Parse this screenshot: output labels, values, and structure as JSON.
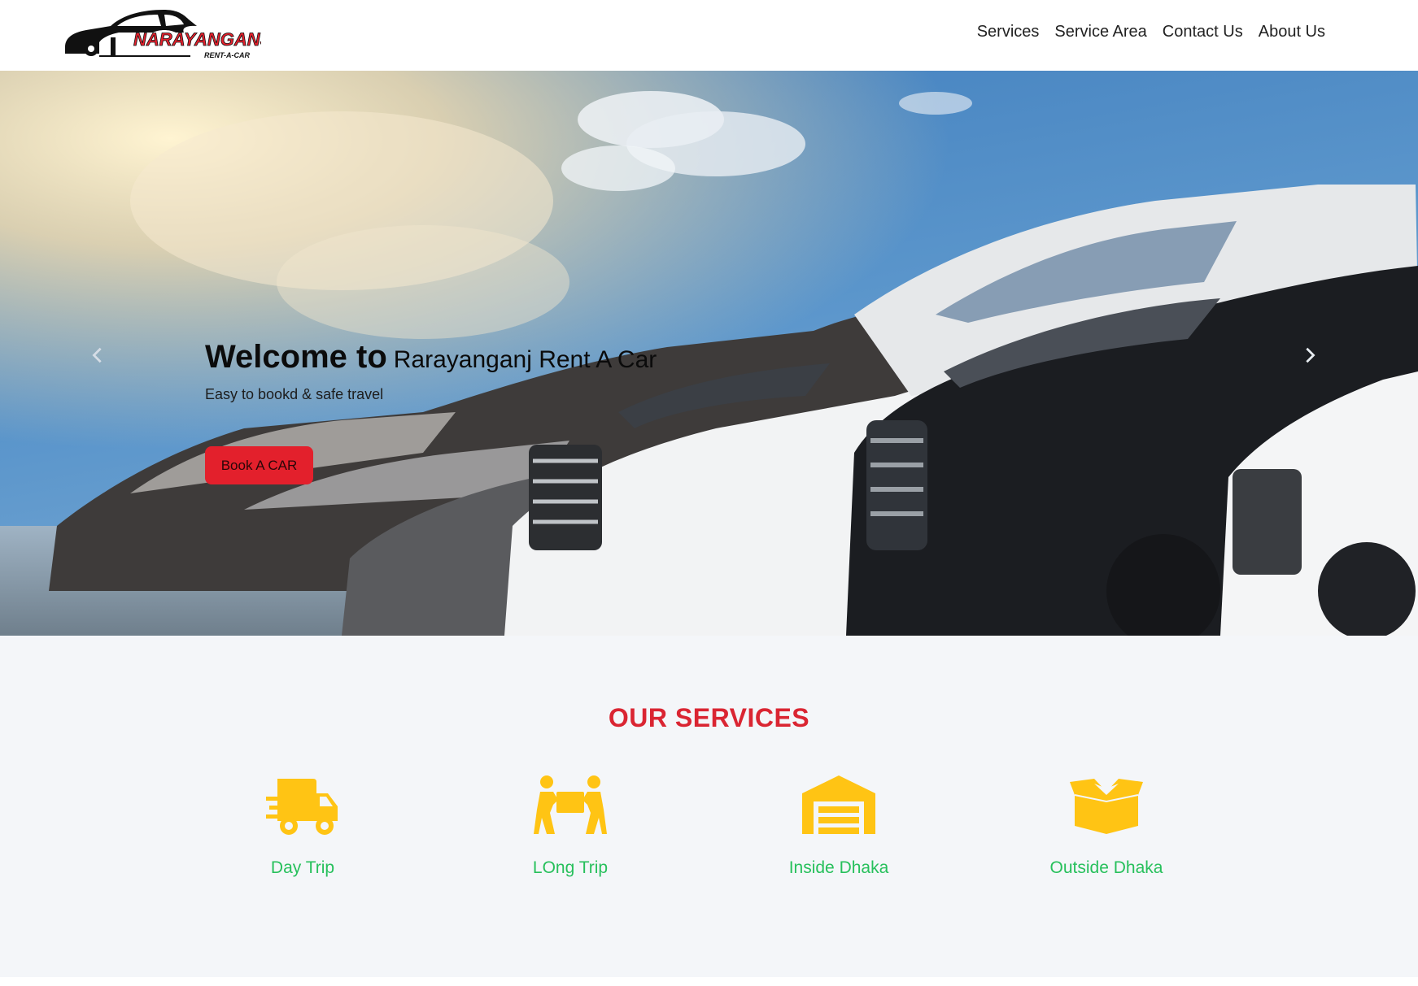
{
  "header": {
    "logo": {
      "name": "NARAYANGANJ",
      "tagline": "RENT-A-CAR"
    },
    "nav": [
      "Services",
      "Service Area",
      "Contact Us",
      "About Us"
    ]
  },
  "hero": {
    "title_strong": "Welcome to",
    "title_light": "Rarayanganj Rent A Car",
    "subtitle": "Easy to bookd & safe travel",
    "button_label": "Book A CAR",
    "prev_icon": "chevron-left-icon",
    "next_icon": "chevron-right-icon"
  },
  "services": {
    "title": "OUR SERVICES",
    "items": [
      {
        "label": "Day Trip",
        "icon": "delivery-truck-icon"
      },
      {
        "label": "LOng Trip",
        "icon": "people-carry-box-icon"
      },
      {
        "label": "Inside Dhaka",
        "icon": "warehouse-icon"
      },
      {
        "label": "Outside Dhaka",
        "icon": "open-box-icon"
      }
    ]
  },
  "colors": {
    "accent_red": "#e3202c",
    "title_red": "#da2532",
    "icon_yellow": "#ffc414",
    "label_green": "#27c05c",
    "services_bg": "#f4f6f9"
  }
}
